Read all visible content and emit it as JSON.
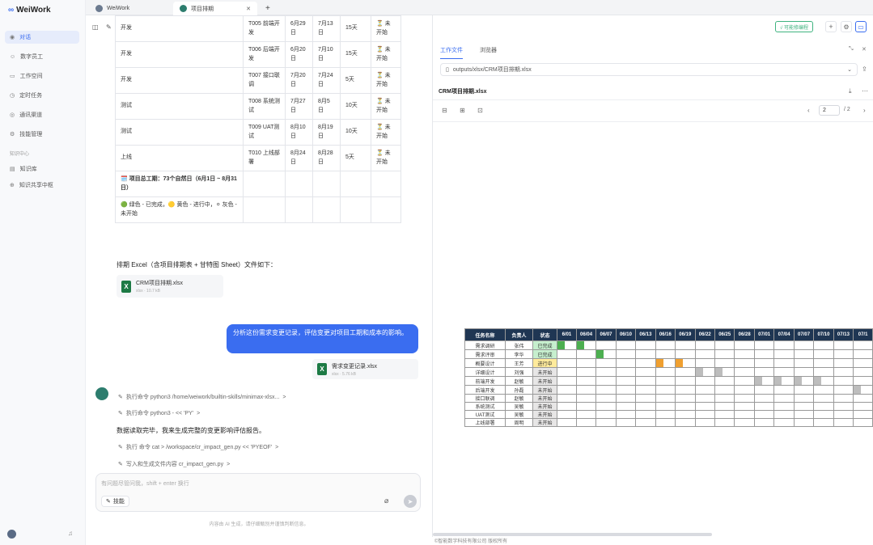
{
  "app": {
    "logo": "WeiWork"
  },
  "sidebar": {
    "items": [
      {
        "label": "对话",
        "icon": "chat-icon"
      },
      {
        "label": "数字员工",
        "icon": "user-icon"
      },
      {
        "label": "工作空间",
        "icon": "folder-icon"
      },
      {
        "label": "定时任务",
        "icon": "clock-icon"
      },
      {
        "label": "通讯渠道",
        "icon": "channel-icon"
      },
      {
        "label": "技能管理",
        "icon": "skill-icon"
      }
    ],
    "section_label": "知识中心",
    "knowledge_items": [
      {
        "label": "知识库",
        "icon": "book-icon"
      },
      {
        "label": "知识共享中枢",
        "icon": "share-icon"
      }
    ]
  },
  "tabs": [
    {
      "label": "WeiWork"
    },
    {
      "label": "项目排期"
    }
  ],
  "new_tab": "+",
  "schedule": {
    "rows": [
      [
        "开发",
        "T005 前端开发",
        "6月29日",
        "7月13日",
        "15天",
        "⏳ 未开始"
      ],
      [
        "开发",
        "T006 后端开发",
        "6月20日",
        "7月10日",
        "15天",
        "⏳ 未开始"
      ],
      [
        "开发",
        "T007 接口联调",
        "7月20日",
        "7月24日",
        "5天",
        "⏳ 未开始"
      ],
      [
        "测试",
        "T008 系统测试",
        "7月27日",
        "8月5日",
        "10天",
        "⏳ 未开始"
      ],
      [
        "测试",
        "T009 UAT测试",
        "8月10日",
        "8月19日",
        "10天",
        "⏳ 未开始"
      ],
      [
        "上线",
        "T010 上线部署",
        "8月24日",
        "8月28日",
        "5天",
        "⏳ 未开始"
      ]
    ],
    "total": "🗓️ 项目总工期：73个自然日（6月1日 ~ 8月31日）",
    "legend": "🟢 绿色 - 已完成，🟡 黄色 - 进行中，⚪ 灰色 - 未开始"
  },
  "chat": {
    "excel_intro": "排期 Excel（含项目排期表 + 甘特图 Sheet）文件如下：",
    "file1": {
      "name": "CRM项目排期.xlsx",
      "meta": "xlsx · 10.7 kB"
    },
    "user_msg": "分析这份需求变更记录，评估变更对项目工期和成本的影响。",
    "file2": {
      "name": "需求变更记录.xlsx",
      "meta": "xlsx · 5.76 kB"
    },
    "steps": [
      "执行命令 python3 /home/weiwork/builtin-skills/minimax-xlsx...",
      "执行命令 python3 - << 'PY'",
      "执行 命令 cat > /workspace/cr_impact_gen.py << 'PYEOF'",
      "写入和生成文件内容 cr_impact_gen.py"
    ],
    "step_arrow": ">",
    "reply": "数据读取完毕，我来生成完整的变更影响评估报告。",
    "input_placeholder": "有问题尽管问我，shift + enter 换行",
    "skill_button": "技能",
    "footer": "内容由 AI 生成，请仔细甄别并谨慎判断信息。"
  },
  "right_panel": {
    "tabs": [
      "工作文件",
      "浏览器"
    ],
    "path": "outputs/xlsx/CRM项目排期.xlsx",
    "file_title": "CRM项目排期.xlsx",
    "page_current": "2",
    "page_total": "/ 2",
    "topbar_badge": "√ 可能修编程",
    "bottom_text": "©智能数字科技有限公司 版权所有"
  },
  "gantt": {
    "headers": [
      "任务名称",
      "负责人",
      "状态"
    ],
    "dates": [
      "6/01",
      "06/04",
      "06/07",
      "06/10",
      "06/13",
      "06/16",
      "06/19",
      "06/22",
      "06/25",
      "06/28",
      "07/01",
      "07/04",
      "07/07",
      "07/10",
      "07/13",
      "07/1"
    ],
    "tasks": [
      {
        "name": "需求调研",
        "owner": "张伟",
        "status": "已完成",
        "st": "done"
      },
      {
        "name": "需求评审",
        "owner": "李华",
        "status": "已完成",
        "st": "done"
      },
      {
        "name": "概要设计",
        "owner": "王芳",
        "status": "进行中",
        "st": "prog"
      },
      {
        "name": "详细设计",
        "owner": "刘强",
        "status": "未开始",
        "st": "none"
      },
      {
        "name": "前端开发",
        "owner": "赵敏",
        "status": "未开始",
        "st": "none"
      },
      {
        "name": "后端开发",
        "owner": "孙磊",
        "status": "未开始",
        "st": "none"
      },
      {
        "name": "接口联调",
        "owner": "赵敏",
        "status": "未开始",
        "st": "none"
      },
      {
        "name": "系统测试",
        "owner": "吴敏",
        "status": "未开始",
        "st": "none"
      },
      {
        "name": "UAT测试",
        "owner": "吴敏",
        "status": "未开始",
        "st": "none"
      },
      {
        "name": "上线部署",
        "owner": "周明",
        "status": "未开始",
        "st": "none"
      }
    ],
    "fills": [
      [
        0,
        1
      ],
      [
        2
      ],
      [
        5,
        6
      ],
      [
        7,
        8
      ],
      [
        10,
        11,
        12,
        13
      ],
      [
        15
      ],
      [],
      [],
      [],
      []
    ],
    "colors": {
      "done": "#4caf50",
      "prog": "#f0a030",
      "none": "#bdbdbd"
    }
  }
}
